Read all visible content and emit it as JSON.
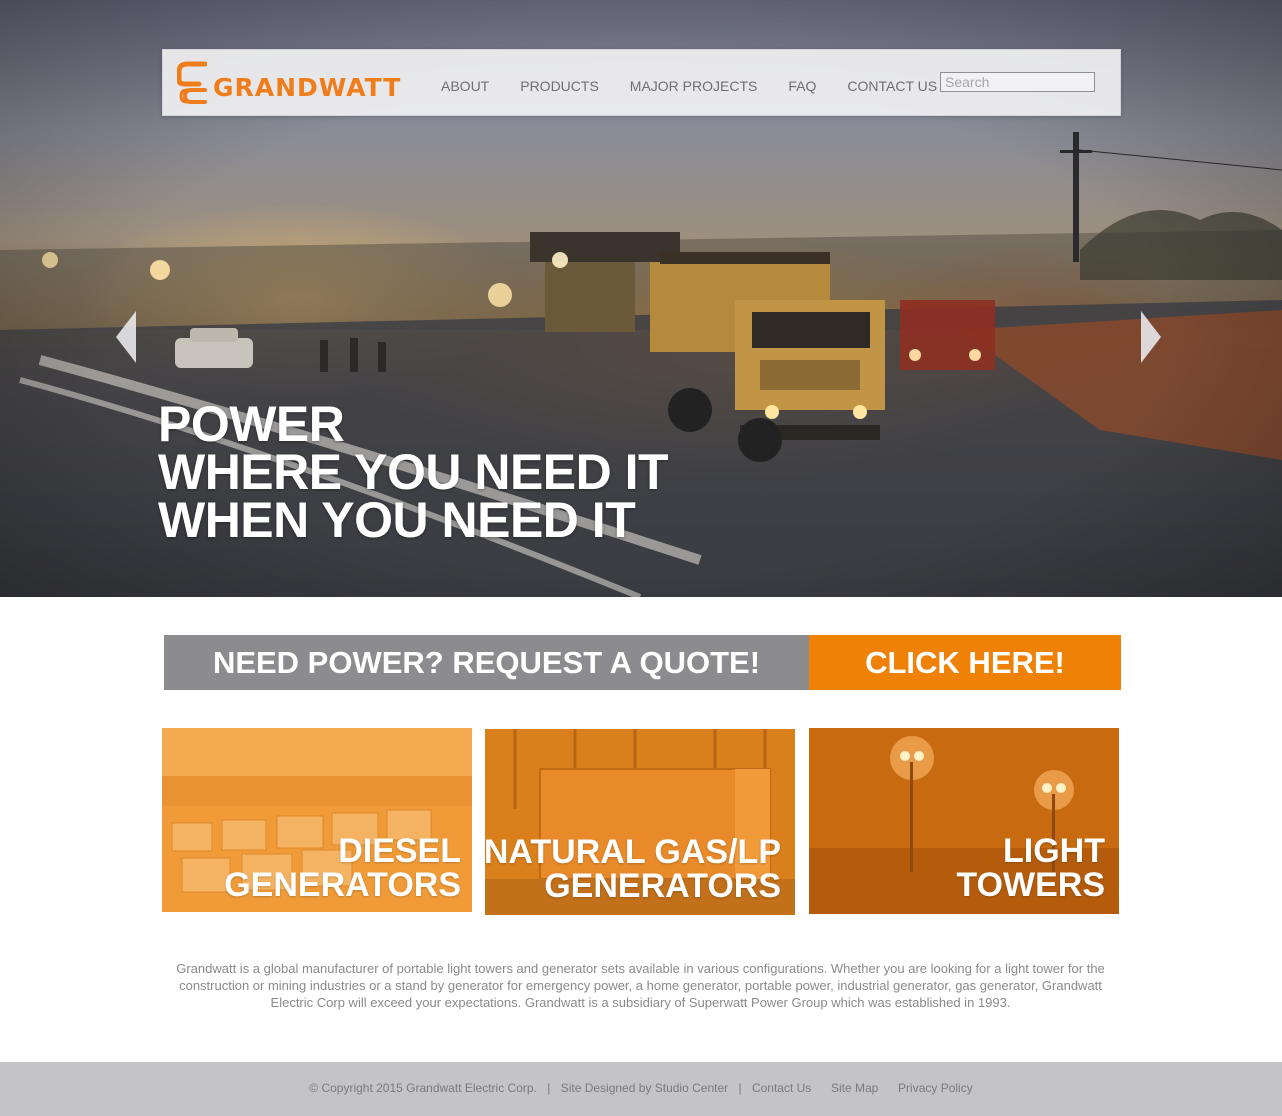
{
  "brand": {
    "name": "GRANDWATT",
    "accent_color": "#ef7d1c",
    "button_color": "#ef8206",
    "bar_gray": "#8c8c8e"
  },
  "nav": {
    "items": [
      {
        "label": "ABOUT"
      },
      {
        "label": "PRODUCTS"
      },
      {
        "label": "MAJOR PROJECTS"
      },
      {
        "label": "FAQ"
      },
      {
        "label": "CONTACT US"
      }
    ],
    "search_placeholder": "Search"
  },
  "hero": {
    "lines": [
      "POWER",
      "WHERE YOU NEED IT",
      "WHEN YOU NEED IT"
    ],
    "prev_icon": "chevron-left-icon",
    "next_icon": "chevron-right-icon"
  },
  "quote": {
    "text": "NEED POWER? REQUEST A QUOTE!",
    "button": "CLICK HERE!"
  },
  "tiles": [
    {
      "line1": "DIESEL",
      "line2": "GENERATORS"
    },
    {
      "line1": "NATURAL GAS/LP",
      "line2": "GENERATORS"
    },
    {
      "line1": "LIGHT",
      "line2": "TOWERS"
    }
  ],
  "about_text": "Grandwatt is a global manufacturer of portable light towers and generator sets available in various configurations. Whether you are looking for a light tower for the construction or mining industries or a stand by generator for emergency power, a home generator, portable power, industrial generator, gas generator, Grandwatt Electric Corp will exceed your expectations. Grandwatt is a subsidiary of Superwatt Power Group which was established in 1993.",
  "footer": {
    "copyright": "© Copyright 2015 Grandwatt Electric Corp.",
    "separator": "|",
    "designed_by": "Site Designed by Studio Center",
    "contact": "Contact Us",
    "sitemap": "Site Map",
    "privacy": "Privacy Policy"
  }
}
